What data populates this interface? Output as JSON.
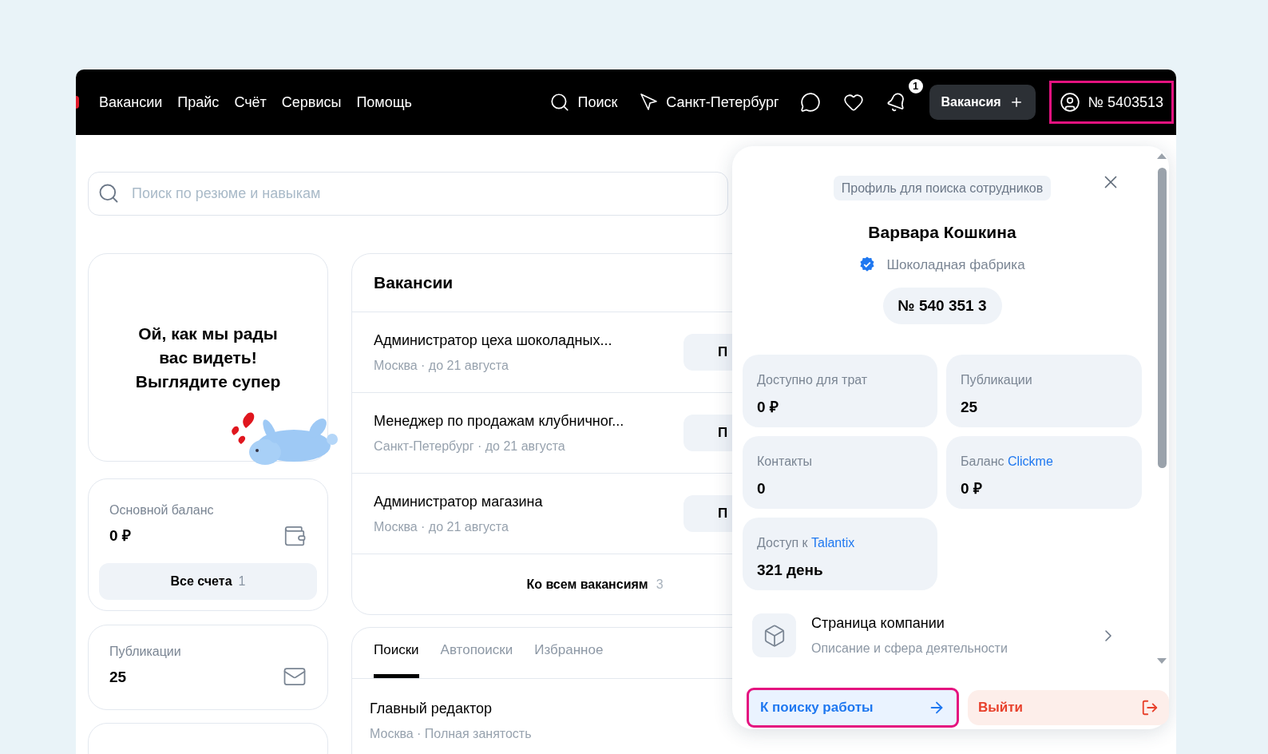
{
  "nav": {
    "links": [
      "Вакансии",
      "Прайс",
      "Счёт",
      "Сервисы",
      "Помощь"
    ],
    "search": "Поиск",
    "city": "Санкт-Петербург",
    "notifications_badge": "1",
    "create_button": "Вакансия",
    "account": {
      "label": "№ 5403513",
      "highlighted": true
    }
  },
  "search": {
    "placeholder": "Поиск по резюме и навыкам"
  },
  "greeting": {
    "lines": [
      "Ой, как мы рады",
      "вас видеть!",
      "Выглядите супер"
    ]
  },
  "balance_card": {
    "label": "Основной баланс",
    "value": "0 ₽",
    "button": "Все счета",
    "count": "1"
  },
  "publications_card": {
    "label": "Публикации",
    "value": "25"
  },
  "vacancies": {
    "title": "Вакансии",
    "items": [
      {
        "title": "Администратор цеха шоколадных...",
        "meta": "Москва · до 21 августа",
        "action": "П"
      },
      {
        "title": "Менеджер по продажам клубничног...",
        "meta": "Санкт-Петербург · до 21 августа",
        "action": "П"
      },
      {
        "title": "Администратор магазина",
        "meta": "Москва · до 21 августа",
        "action": "П"
      }
    ],
    "footer": "Ко всем вакансиям",
    "footer_count": "3"
  },
  "searches": {
    "tabs": [
      {
        "label": "Поиски",
        "selected": true
      },
      {
        "label": "Автопоиски",
        "selected": false
      },
      {
        "label": "Избранное",
        "selected": false
      }
    ],
    "items": [
      {
        "title": "Главный редактор",
        "meta": "Москва · Полная занятость"
      }
    ]
  },
  "profile_panel": {
    "role_badge": "Профиль для поиска сотрудников",
    "name": "Варвара Кошкина",
    "company": "Шоколадная фабрика",
    "verified": true,
    "number": "№ 540 351 3",
    "stats": [
      {
        "label": "Доступно для трат",
        "value": "0 ₽"
      },
      {
        "label": "Публикации",
        "value": "25"
      },
      {
        "label": "Контакты",
        "value": "0"
      },
      {
        "label": "Баланс",
        "link": "Clickme",
        "value": "0 ₽"
      },
      {
        "label": "Доступ к",
        "link": "Talantix",
        "value": "321 день"
      }
    ],
    "company_page": {
      "title": "Страница компании",
      "subtitle": "Описание и сфера деятельности"
    },
    "job_search_button": {
      "label": "К поиску работы",
      "highlighted": true
    },
    "logout_button": {
      "label": "Выйти",
      "highlighted": false
    }
  }
}
